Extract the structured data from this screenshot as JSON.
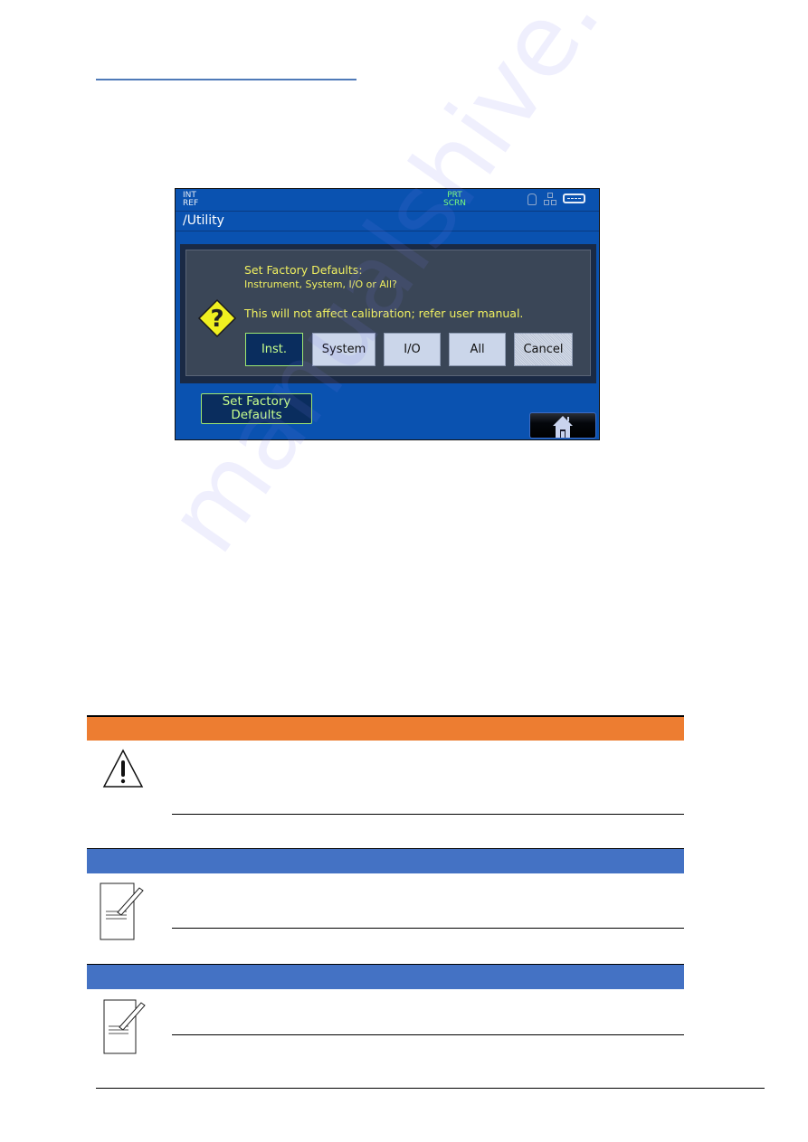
{
  "instrument_screen": {
    "status": {
      "ref_line1": "INT",
      "ref_line2": "REF",
      "print_line1": "PRT",
      "print_line2": "SCRN",
      "icons": [
        "lock-icon",
        "network-icon",
        "usb-icon"
      ]
    },
    "path": "/Utility",
    "dialog": {
      "title": "Set Factory Defaults:",
      "question": "Instrument, System, I/O or All?",
      "note": "This will not affect calibration; refer user manual.",
      "icon": "question-diamond-icon",
      "buttons": {
        "inst": "Inst.",
        "system": "System",
        "io": "I/O",
        "all": "All",
        "cancel": "Cancel"
      }
    },
    "softkey": {
      "line1": "Set Factory",
      "line2": "Defaults"
    },
    "home_icon": "home-icon"
  },
  "callouts": [
    {
      "type": "warning",
      "icon": "warning-triangle-icon",
      "bar_color": "#ed7d31"
    },
    {
      "type": "note",
      "icon": "note-pencil-icon",
      "bar_color": "#4472c4"
    },
    {
      "type": "note",
      "icon": "note-pencil-icon",
      "bar_color": "#4472c4"
    }
  ],
  "watermark": "manualshive.com",
  "colors": {
    "screen_bg": "#0a52b0",
    "dialog_text": "#f0f060",
    "selected_text": "#c8ff8c",
    "title_rule": "#4f7ab8"
  }
}
